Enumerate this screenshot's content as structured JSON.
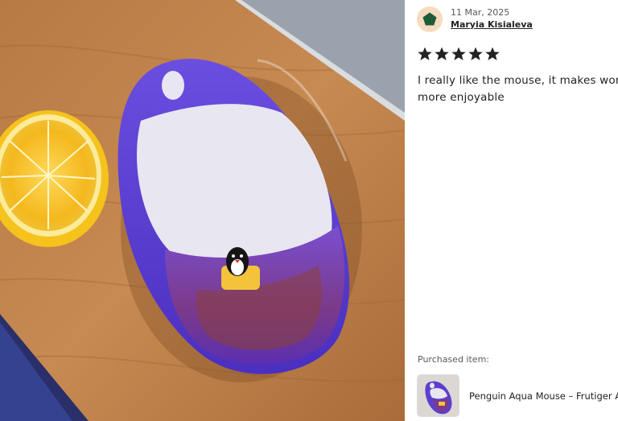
{
  "review": {
    "date": "11 Mar, 2025",
    "author": "Maryia Kisialeva",
    "rating": 5,
    "rating_max": 5,
    "text": "I really like the mouse, it makes work more enjoyable"
  },
  "purchased": {
    "label": "Purchased item:",
    "item_title": "Penguin Aqua Mouse – Frutiger Ae"
  },
  "icons": {
    "avatar": "green-pentagon-avatar-icon",
    "star": "star-filled-icon"
  },
  "colors": {
    "star": "#222222",
    "avatar_bg": "#f6dcc0",
    "avatar_shape": "#1f5b3a",
    "mouse_purple": "#5a3fd0"
  }
}
